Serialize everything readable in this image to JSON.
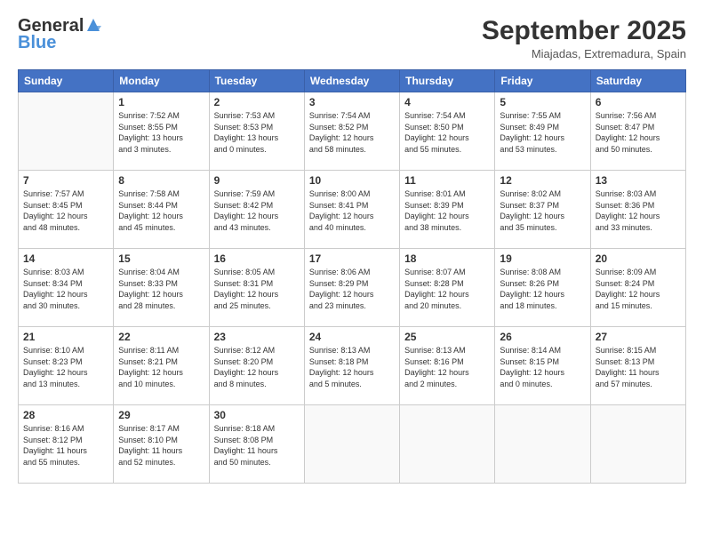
{
  "header": {
    "logo_general": "General",
    "logo_blue": "Blue",
    "month_title": "September 2025",
    "subtitle": "Miajadas, Extremadura, Spain"
  },
  "days_of_week": [
    "Sunday",
    "Monday",
    "Tuesday",
    "Wednesday",
    "Thursday",
    "Friday",
    "Saturday"
  ],
  "weeks": [
    [
      {
        "day": "",
        "info": ""
      },
      {
        "day": "1",
        "info": "Sunrise: 7:52 AM\nSunset: 8:55 PM\nDaylight: 13 hours\nand 3 minutes."
      },
      {
        "day": "2",
        "info": "Sunrise: 7:53 AM\nSunset: 8:53 PM\nDaylight: 13 hours\nand 0 minutes."
      },
      {
        "day": "3",
        "info": "Sunrise: 7:54 AM\nSunset: 8:52 PM\nDaylight: 12 hours\nand 58 minutes."
      },
      {
        "day": "4",
        "info": "Sunrise: 7:54 AM\nSunset: 8:50 PM\nDaylight: 12 hours\nand 55 minutes."
      },
      {
        "day": "5",
        "info": "Sunrise: 7:55 AM\nSunset: 8:49 PM\nDaylight: 12 hours\nand 53 minutes."
      },
      {
        "day": "6",
        "info": "Sunrise: 7:56 AM\nSunset: 8:47 PM\nDaylight: 12 hours\nand 50 minutes."
      }
    ],
    [
      {
        "day": "7",
        "info": "Sunrise: 7:57 AM\nSunset: 8:45 PM\nDaylight: 12 hours\nand 48 minutes."
      },
      {
        "day": "8",
        "info": "Sunrise: 7:58 AM\nSunset: 8:44 PM\nDaylight: 12 hours\nand 45 minutes."
      },
      {
        "day": "9",
        "info": "Sunrise: 7:59 AM\nSunset: 8:42 PM\nDaylight: 12 hours\nand 43 minutes."
      },
      {
        "day": "10",
        "info": "Sunrise: 8:00 AM\nSunset: 8:41 PM\nDaylight: 12 hours\nand 40 minutes."
      },
      {
        "day": "11",
        "info": "Sunrise: 8:01 AM\nSunset: 8:39 PM\nDaylight: 12 hours\nand 38 minutes."
      },
      {
        "day": "12",
        "info": "Sunrise: 8:02 AM\nSunset: 8:37 PM\nDaylight: 12 hours\nand 35 minutes."
      },
      {
        "day": "13",
        "info": "Sunrise: 8:03 AM\nSunset: 8:36 PM\nDaylight: 12 hours\nand 33 minutes."
      }
    ],
    [
      {
        "day": "14",
        "info": "Sunrise: 8:03 AM\nSunset: 8:34 PM\nDaylight: 12 hours\nand 30 minutes."
      },
      {
        "day": "15",
        "info": "Sunrise: 8:04 AM\nSunset: 8:33 PM\nDaylight: 12 hours\nand 28 minutes."
      },
      {
        "day": "16",
        "info": "Sunrise: 8:05 AM\nSunset: 8:31 PM\nDaylight: 12 hours\nand 25 minutes."
      },
      {
        "day": "17",
        "info": "Sunrise: 8:06 AM\nSunset: 8:29 PM\nDaylight: 12 hours\nand 23 minutes."
      },
      {
        "day": "18",
        "info": "Sunrise: 8:07 AM\nSunset: 8:28 PM\nDaylight: 12 hours\nand 20 minutes."
      },
      {
        "day": "19",
        "info": "Sunrise: 8:08 AM\nSunset: 8:26 PM\nDaylight: 12 hours\nand 18 minutes."
      },
      {
        "day": "20",
        "info": "Sunrise: 8:09 AM\nSunset: 8:24 PM\nDaylight: 12 hours\nand 15 minutes."
      }
    ],
    [
      {
        "day": "21",
        "info": "Sunrise: 8:10 AM\nSunset: 8:23 PM\nDaylight: 12 hours\nand 13 minutes."
      },
      {
        "day": "22",
        "info": "Sunrise: 8:11 AM\nSunset: 8:21 PM\nDaylight: 12 hours\nand 10 minutes."
      },
      {
        "day": "23",
        "info": "Sunrise: 8:12 AM\nSunset: 8:20 PM\nDaylight: 12 hours\nand 8 minutes."
      },
      {
        "day": "24",
        "info": "Sunrise: 8:13 AM\nSunset: 8:18 PM\nDaylight: 12 hours\nand 5 minutes."
      },
      {
        "day": "25",
        "info": "Sunrise: 8:13 AM\nSunset: 8:16 PM\nDaylight: 12 hours\nand 2 minutes."
      },
      {
        "day": "26",
        "info": "Sunrise: 8:14 AM\nSunset: 8:15 PM\nDaylight: 12 hours\nand 0 minutes."
      },
      {
        "day": "27",
        "info": "Sunrise: 8:15 AM\nSunset: 8:13 PM\nDaylight: 11 hours\nand 57 minutes."
      }
    ],
    [
      {
        "day": "28",
        "info": "Sunrise: 8:16 AM\nSunset: 8:12 PM\nDaylight: 11 hours\nand 55 minutes."
      },
      {
        "day": "29",
        "info": "Sunrise: 8:17 AM\nSunset: 8:10 PM\nDaylight: 11 hours\nand 52 minutes."
      },
      {
        "day": "30",
        "info": "Sunrise: 8:18 AM\nSunset: 8:08 PM\nDaylight: 11 hours\nand 50 minutes."
      },
      {
        "day": "",
        "info": ""
      },
      {
        "day": "",
        "info": ""
      },
      {
        "day": "",
        "info": ""
      },
      {
        "day": "",
        "info": ""
      }
    ]
  ]
}
